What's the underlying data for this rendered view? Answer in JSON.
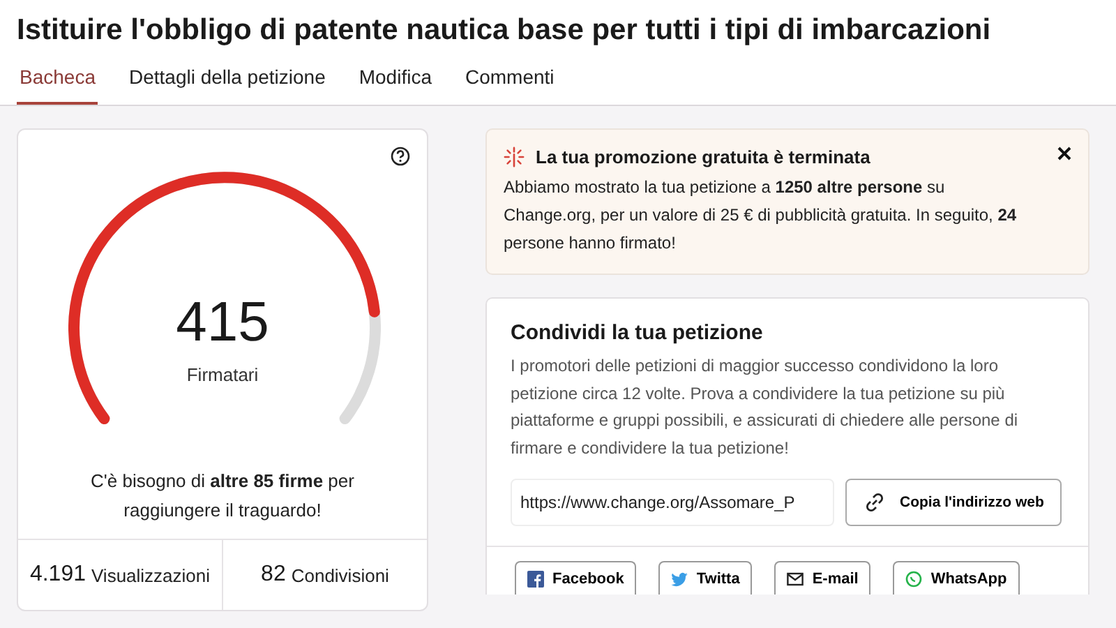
{
  "title": "Istituire l'obbligo di patente nautica base per tutti i tipi di imbarcazioni",
  "tabs": [
    {
      "label": "Bacheca",
      "selected": true
    },
    {
      "label": "Dettagli della petizione",
      "selected": false
    },
    {
      "label": "Modifica",
      "selected": false
    },
    {
      "label": "Commenti",
      "selected": false
    }
  ],
  "progress": {
    "count": "415",
    "label": "Firmatari",
    "message": "C'è bisogno di **altre 85 firme** per raggiungere il traguardo!"
  },
  "stats": [
    {
      "value": "4.191",
      "label": "Visualizzazioni"
    },
    {
      "value": "82",
      "label": "Condivisioni"
    }
  ],
  "promo": {
    "title": "La tua promozione gratuita è terminata",
    "text": "Abbiamo mostrato la tua petizione a **1250 altre persone** su Change.org, per un valore di 25 € di pubblicità gratuita. In seguito, **24** persone hanno firmato!"
  },
  "share": {
    "title": "Condividi la tua petizione",
    "text": "I promotori delle petizioni di maggior successo condividono la loro petizione circa 12 volte. Prova a condividere la tua petizione su più piattaforme e gruppi possibili, e assicurati di chiedere alle persone di firmare e condividere la tua petizione!",
    "url": "https://www.change.org/Assomare_P",
    "copy_button": "Copia l'indirizzo web",
    "buttons": [
      {
        "kind": "facebook",
        "label": "Facebook"
      },
      {
        "kind": "twitter",
        "label": "Twitta"
      },
      {
        "kind": "email",
        "label": "E-mail"
      },
      {
        "kind": "whatsapp",
        "label": "WhatsApp"
      }
    ]
  }
}
